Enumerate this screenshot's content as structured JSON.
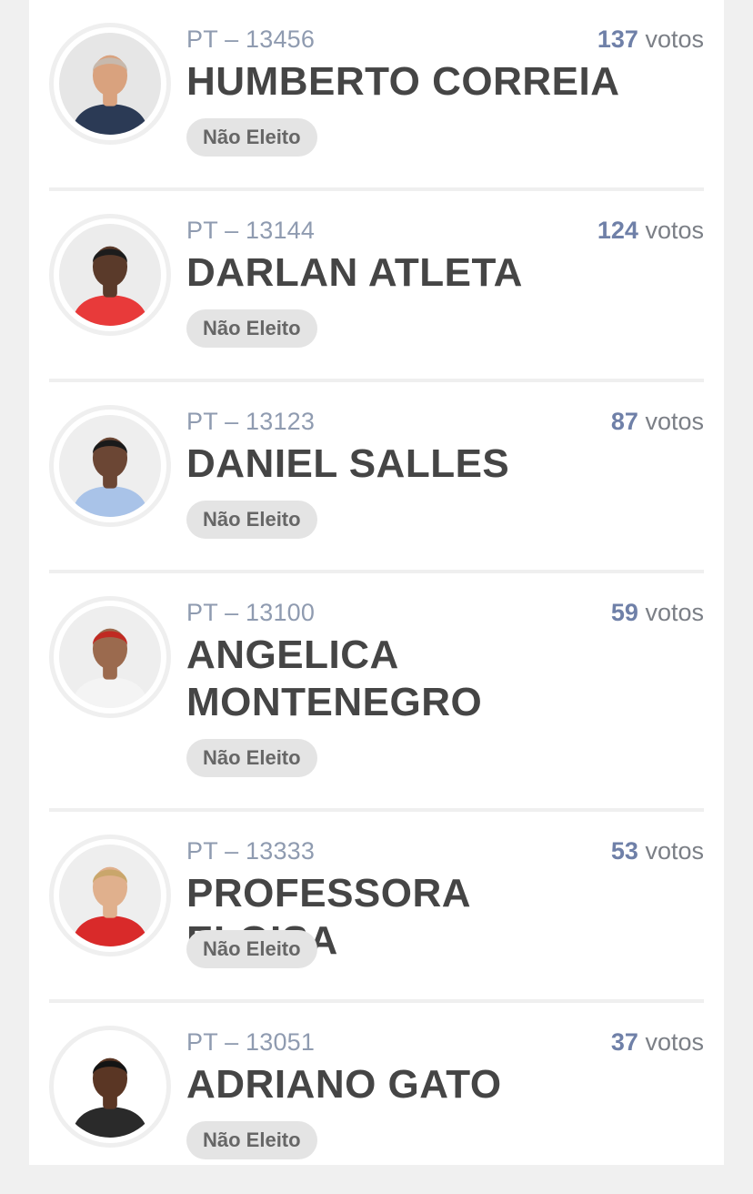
{
  "candidates": [
    {
      "party_number": "PT – 13456",
      "votes": "137",
      "votes_label": "votos",
      "name": "HUMBERTO CORREIA",
      "status": "Não Eleito",
      "shirt_color": "#2b3a55",
      "skin_color": "#d9a27e",
      "hair_color": "#c7b9ad",
      "bg_color": "#e6e6e6"
    },
    {
      "party_number": "PT – 13144",
      "votes": "124",
      "votes_label": "votos",
      "name": "DARLAN ATLETA",
      "status": "Não Eleito",
      "shirt_color": "#e83a3a",
      "skin_color": "#5a3a2a",
      "hair_color": "#1c1c1c",
      "bg_color": "#ececec"
    },
    {
      "party_number": "PT – 13123",
      "votes": "87",
      "votes_label": "votos",
      "name": "DANIEL SALLES",
      "status": "Não Eleito",
      "shirt_color": "#a9c3e8",
      "skin_color": "#6b4634",
      "hair_color": "#1a1a1a",
      "bg_color": "#eeeeee"
    },
    {
      "party_number": "PT – 13100",
      "votes": "59",
      "votes_label": "votos",
      "name": "ANGELICA MONTENEGRO",
      "status": "Não Eleito",
      "shirt_color": "#f4f4f4",
      "skin_color": "#9b6a4e",
      "hair_color": "#c02a22",
      "bg_color": "#eeeeee"
    },
    {
      "party_number": "PT – 13333",
      "votes": "53",
      "votes_label": "votos",
      "name": "PROFESSORA ELOISA",
      "status": "Não Eleito",
      "shirt_color": "#d92a2a",
      "skin_color": "#e0b08d",
      "hair_color": "#c9a66b",
      "bg_color": "#eeeeee"
    },
    {
      "party_number": "PT – 13051",
      "votes": "37",
      "votes_label": "votos",
      "name": "ADRIANO GATO",
      "status": "Não Eleito",
      "shirt_color": "#2a2a2a",
      "skin_color": "#5a3624",
      "hair_color": "#141414",
      "bg_color": "#ffffff"
    }
  ]
}
